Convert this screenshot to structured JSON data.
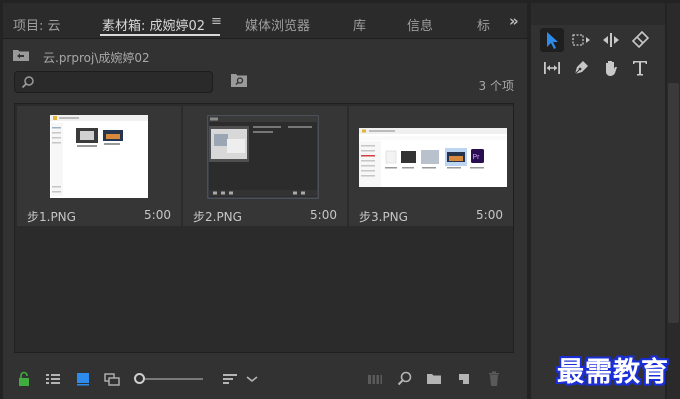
{
  "tabs": [
    {
      "label": "项目: 云",
      "active": false
    },
    {
      "label": "素材箱: 成婉婷02",
      "active": true
    },
    {
      "label": "媒体浏览器",
      "active": false
    },
    {
      "label": "库",
      "active": false
    },
    {
      "label": "信息",
      "active": false
    },
    {
      "label": "标",
      "active": false
    }
  ],
  "tab_menu_icon": "≡",
  "tab_overflow_icon": "»",
  "path": "云.prproj\\成婉婷02",
  "search": {
    "placeholder": ""
  },
  "item_count": "3 个项",
  "items": [
    {
      "name": "步1.PNG",
      "duration": "5:00"
    },
    {
      "name": "步2.PNG",
      "duration": "5:00"
    },
    {
      "name": "步3.PNG",
      "duration": "5:00"
    }
  ],
  "bottom_icons": [
    "lock-icon",
    "list-view-icon",
    "icon-view-icon",
    "freeform-view-icon",
    "zoom-slider",
    "sort-icon",
    "chevron-down-icon",
    "automate-to-sequence-icon",
    "find-icon",
    "new-bin-icon",
    "new-item-icon",
    "trash-icon"
  ],
  "tools": [
    "selection-tool-icon",
    "track-select-icon",
    "ripple-edit-icon",
    "razor-icon",
    "slip-icon",
    "pen-icon",
    "hand-icon",
    "type-icon"
  ],
  "watermark": "最需教育",
  "colors": {
    "accent": "#2d8ceb",
    "lock": "#3fae3f",
    "watermark_outline": "#1a2fd8"
  }
}
